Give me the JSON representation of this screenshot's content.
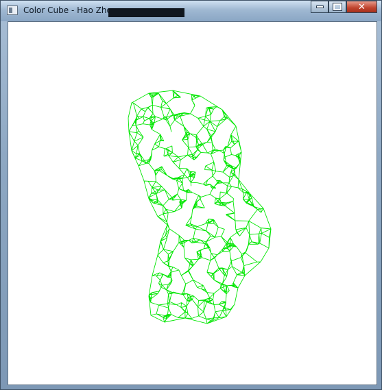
{
  "window": {
    "title": "Color Cube - Hao Zhou",
    "controls": {
      "minimize_icon": "minimize-icon",
      "maximize_icon": "maximize-icon",
      "close_label": "✕"
    }
  },
  "viewport": {
    "background": "#ffffff",
    "mesh_color": "#00e600",
    "icon": "wireframe-bust-model"
  }
}
